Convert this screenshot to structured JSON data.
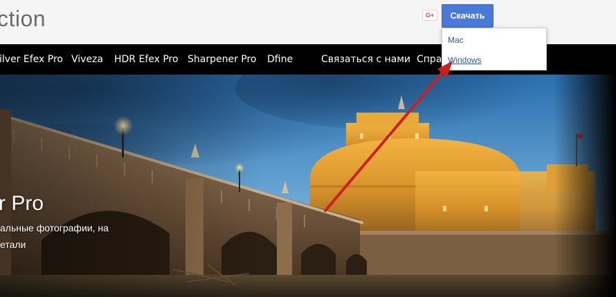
{
  "header": {
    "brand_fragment": "ction",
    "share_icon_label": "G+",
    "download_label": "Скачать"
  },
  "dropdown": {
    "items": [
      "Mac",
      "Windows"
    ]
  },
  "nav": {
    "items": [
      "ilver Efex Pro",
      "Viveza",
      "HDR Efex Pro",
      "Sharpener Pro",
      "Dfine",
      "Связаться с нами",
      "Справ"
    ]
  },
  "hero": {
    "title_fragment": "r Pro",
    "text_line1": "альные фотографии, на",
    "text_line2": "етали"
  },
  "colors": {
    "nav_background": "#000000",
    "download_button": "#4a79d8",
    "link_color": "#2a5aa8",
    "arrow_color": "#cc1f1f"
  }
}
